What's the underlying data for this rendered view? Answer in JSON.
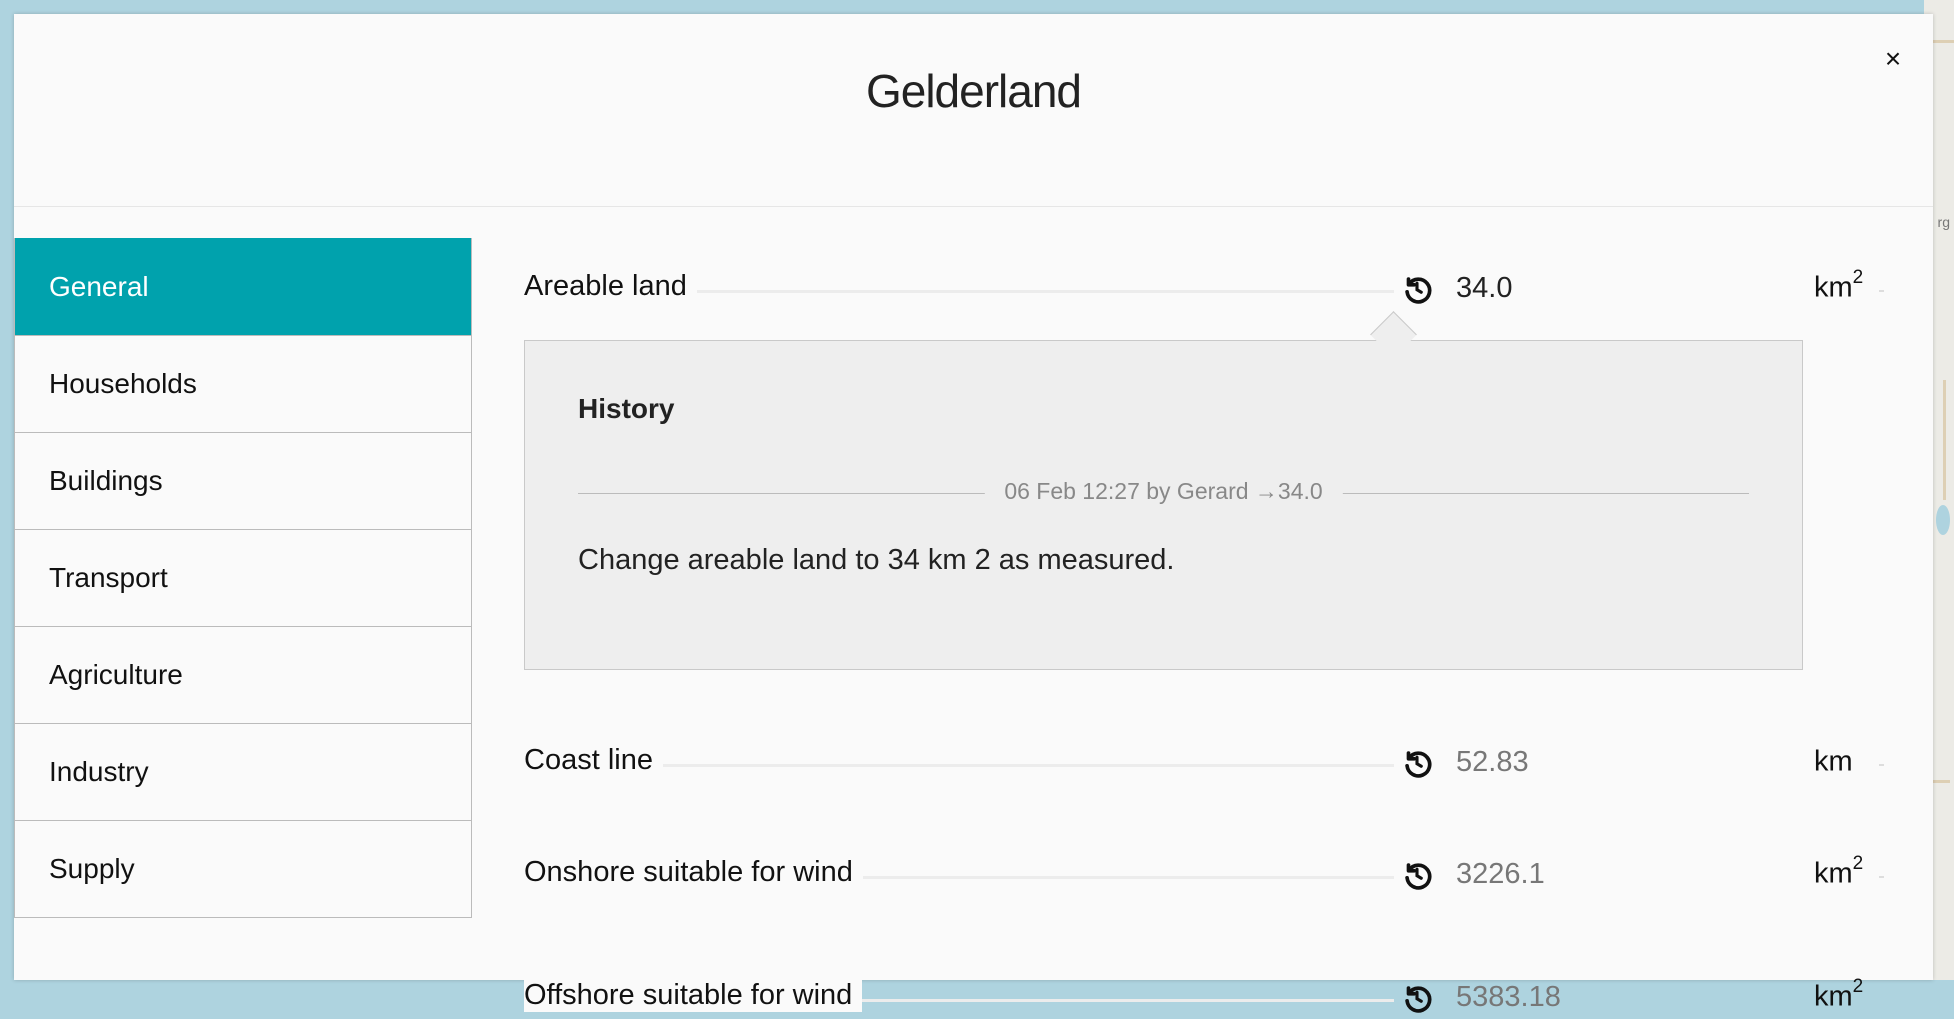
{
  "modal": {
    "title": "Gelderland",
    "close_label": "×"
  },
  "sidebar": {
    "items": [
      {
        "label": "General",
        "active": true
      },
      {
        "label": "Households"
      },
      {
        "label": "Buildings"
      },
      {
        "label": "Transport"
      },
      {
        "label": "Agriculture"
      },
      {
        "label": "Industry"
      },
      {
        "label": "Supply"
      }
    ]
  },
  "rows": [
    {
      "label": "Areable land",
      "value": "34.0",
      "unit": "km",
      "unit_sup": "2",
      "icon": "history-icon"
    },
    {
      "label": "Coast line",
      "value": "52.83",
      "unit": "km",
      "unit_sup": "",
      "icon": "history-icon"
    },
    {
      "label": "Onshore suitable for wind",
      "value": "3226.1",
      "unit": "km",
      "unit_sup": "2",
      "icon": "history-icon"
    },
    {
      "label": "Offshore suitable for wind",
      "value": "5383.18",
      "unit": "km",
      "unit_sup": "2",
      "icon": "history-icon"
    }
  ],
  "history": {
    "title": "History",
    "entry_meta": "06 Feb 12:27 by Gerard →34.0",
    "entry_text": "Change areable land to 34 km 2 as measured."
  },
  "map": {
    "label": "rg"
  },
  "colors": {
    "accent": "#00a2ad",
    "map_water": "#aed3df"
  }
}
